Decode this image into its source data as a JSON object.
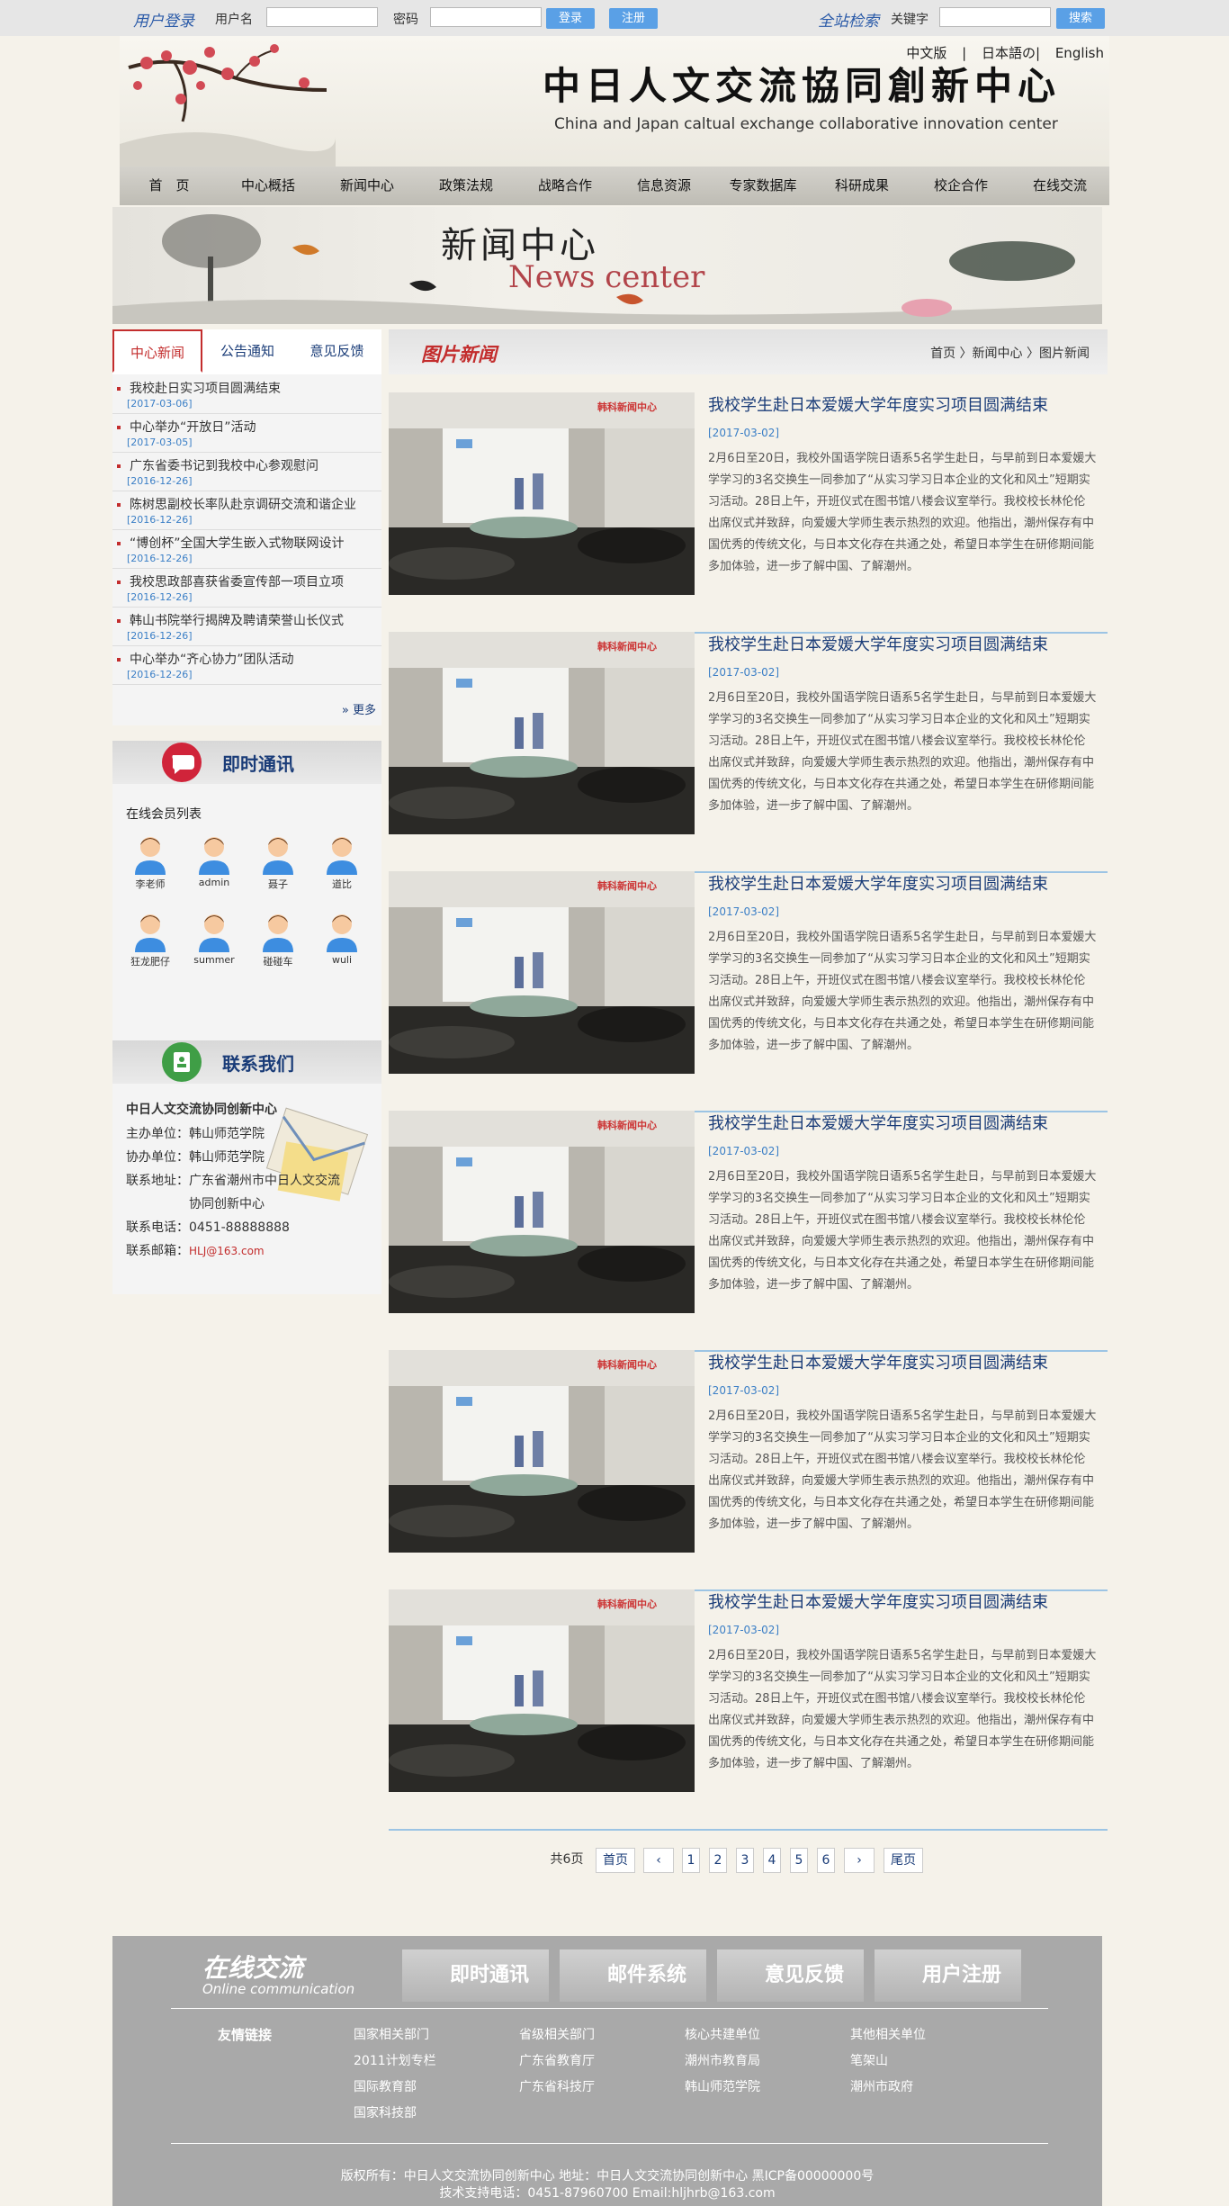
{
  "topbar": {
    "login_label": "用户登录",
    "username_label": "用户名",
    "username_value": "",
    "password_label": "密码",
    "password_value": "",
    "login_button": "登录",
    "register_button": "注册",
    "site_search_label": "全站检索",
    "keyword_label": "关键字",
    "keyword_value": "",
    "search_button": "搜索"
  },
  "header": {
    "title": "中日人文交流協同創新中心",
    "subtitle": "China and Japan caltual exchange collaborative innovation center",
    "languages": [
      "中文版",
      "|",
      "日本語の|",
      "English"
    ]
  },
  "nav": [
    "首　页",
    "中心概括",
    "新闻中心",
    "政策法规",
    "战略合作",
    "信息资源",
    "专家数据库",
    "科研成果",
    "校企合作",
    "在线交流"
  ],
  "banner": {
    "cn": "新闻中心",
    "en": "News center"
  },
  "sidebar": {
    "tabs": [
      "中心新闻",
      "公告通知",
      "意见反馈"
    ],
    "news": [
      {
        "title": "我校赴日实习项目圆满结束",
        "date": "[2017-03-06]"
      },
      {
        "title": "中心举办“开放日”活动",
        "date": "[2017-03-05]"
      },
      {
        "title": "广东省委书记到我校中心参观慰问",
        "date": "[2016-12-26]"
      },
      {
        "title": "陈树思副校长率队赴京调研交流和谐企业",
        "date": "[2016-12-26]"
      },
      {
        "title": "“博创杯”全国大学生嵌入式物联网设计",
        "date": "[2016-12-26]"
      },
      {
        "title": "我校思政部喜获省委宣传部一项目立项",
        "date": "[2016-12-26]"
      },
      {
        "title": "韩山书院举行揭牌及聘请荣誉山长仪式",
        "date": "[2016-12-26]"
      },
      {
        "title": "中心举办“齐心协力”团队活动",
        "date": "[2016-12-26]"
      }
    ],
    "more": "更多",
    "im_title": "即时通讯",
    "online_label": "在线会员列表",
    "members": [
      "李老师",
      "admin",
      "聂子",
      "道比",
      "狂龙肥仔",
      "summer",
      "碰碰车",
      "wuli"
    ],
    "contact_title": "联系我们",
    "contact": {
      "org": "中日人文交流协同创新中心",
      "host": "主办单位：韩山师范学院",
      "co": "协办单位：韩山师范学院",
      "addr1": "联系地址：广东省潮州市中日人文交流",
      "addr2": "协同创新中心",
      "phone": "联系电话：0451-88888888",
      "email_label": "联系邮箱：",
      "email": "HLJ@163.com"
    }
  },
  "main": {
    "title": "图片新闻",
    "breadcrumb": "首页 〉新闻中心 〉图片新闻",
    "photo_caption": "韩科新闻中心",
    "articles": [
      {
        "title": "我校学生赴日本爱媛大学年度实习项目圆满结束",
        "date": "[2017-03-02]",
        "body": "2月6日至20日，我校外国语学院日语系5名学生赴日，与早前到日本爱媛大学学习的3名交换生一同参加了“从实习学习日本企业的文化和风土”短期实习活动。28日上午，开班仪式在图书馆八楼会议室举行。我校校长林伦伦出席仪式并致辞，向爱媛大学师生表示热烈的欢迎。他指出，潮州保存有中国优秀的传统文化，与日本文化存在共通之处，希望日本学生在研修期间能多加体验，进一步了解中国、了解潮州。"
      },
      {
        "title": "我校学生赴日本爱媛大学年度实习项目圆满结束",
        "date": "[2017-03-02]",
        "body": "2月6日至20日，我校外国语学院日语系5名学生赴日，与早前到日本爱媛大学学习的3名交换生一同参加了“从实习学习日本企业的文化和风土”短期实习活动。28日上午，开班仪式在图书馆八楼会议室举行。我校校长林伦伦出席仪式并致辞，向爱媛大学师生表示热烈的欢迎。他指出，潮州保存有中国优秀的传统文化，与日本文化存在共通之处，希望日本学生在研修期间能多加体验，进一步了解中国、了解潮州。"
      },
      {
        "title": "我校学生赴日本爱媛大学年度实习项目圆满结束",
        "date": "[2017-03-02]",
        "body": "2月6日至20日，我校外国语学院日语系5名学生赴日，与早前到日本爱媛大学学习的3名交换生一同参加了“从实习学习日本企业的文化和风土”短期实习活动。28日上午，开班仪式在图书馆八楼会议室举行。我校校长林伦伦出席仪式并致辞，向爱媛大学师生表示热烈的欢迎。他指出，潮州保存有中国优秀的传统文化，与日本文化存在共通之处，希望日本学生在研修期间能多加体验，进一步了解中国、了解潮州。"
      },
      {
        "title": "我校学生赴日本爱媛大学年度实习项目圆满结束",
        "date": "[2017-03-02]",
        "body": "2月6日至20日，我校外国语学院日语系5名学生赴日，与早前到日本爱媛大学学习的3名交换生一同参加了“从实习学习日本企业的文化和风土”短期实习活动。28日上午，开班仪式在图书馆八楼会议室举行。我校校长林伦伦出席仪式并致辞，向爱媛大学师生表示热烈的欢迎。他指出，潮州保存有中国优秀的传统文化，与日本文化存在共通之处，希望日本学生在研修期间能多加体验，进一步了解中国、了解潮州。"
      },
      {
        "title": "我校学生赴日本爱媛大学年度实习项目圆满结束",
        "date": "[2017-03-02]",
        "body": "2月6日至20日，我校外国语学院日语系5名学生赴日，与早前到日本爱媛大学学习的3名交换生一同参加了“从实习学习日本企业的文化和风土”短期实习活动。28日上午，开班仪式在图书馆八楼会议室举行。我校校长林伦伦出席仪式并致辞，向爱媛大学师生表示热烈的欢迎。他指出，潮州保存有中国优秀的传统文化，与日本文化存在共通之处，希望日本学生在研修期间能多加体验，进一步了解中国、了解潮州。"
      },
      {
        "title": "我校学生赴日本爱媛大学年度实习项目圆满结束",
        "date": "[2017-03-02]",
        "body": "2月6日至20日，我校外国语学院日语系5名学生赴日，与早前到日本爱媛大学学习的3名交换生一同参加了“从实习学习日本企业的文化和风土”短期实习活动。28日上午，开班仪式在图书馆八楼会议室举行。我校校长林伦伦出席仪式并致辞，向爱媛大学师生表示热烈的欢迎。他指出，潮州保存有中国优秀的传统文化，与日本文化存在共通之处，希望日本学生在研修期间能多加体验，进一步了解中国、了解潮州。"
      }
    ]
  },
  "pager": {
    "total": "共6页",
    "first": "首页",
    "prev": "‹",
    "pages": [
      "1",
      "2",
      "3",
      "4",
      "5",
      "6"
    ],
    "next": "›",
    "last": "尾页"
  },
  "footer": {
    "title": "在线交流",
    "subtitle": "Online communication",
    "buttons": [
      "即时通讯",
      "邮件系统",
      "意见反馈",
      "用户注册"
    ],
    "links_label": "友情链接",
    "links": [
      [
        "国家相关部门",
        "省级相关部门",
        "核心共建单位",
        "其他相关单位"
      ],
      [
        "2011计划专栏",
        "广东省教育厅",
        "潮州市教育局",
        "笔架山"
      ],
      [
        "国际教育部",
        "广东省科技厅",
        "韩山师范学院",
        "潮州市政府"
      ],
      [
        "国家科技部"
      ]
    ],
    "copyright": "版权所有：中日人文交流协同创新中心 地址：中日人文交流协同创新中心 黑ICP备00000000号",
    "support": "技术支持电话：0451-87960700 Email:hljhrb@163.com"
  },
  "colors": {
    "accent_red": "#c32d2d",
    "link_blue": "#1a3c78",
    "date_blue": "#3b7fc6",
    "button_blue": "#5aa0e6",
    "footer_gray": "#a9a9a9"
  },
  "icons": [
    "user-avatar-icon",
    "chat-bubble-icon",
    "contact-card-icon",
    "envelope-icon",
    "double-chevron-icon"
  ]
}
